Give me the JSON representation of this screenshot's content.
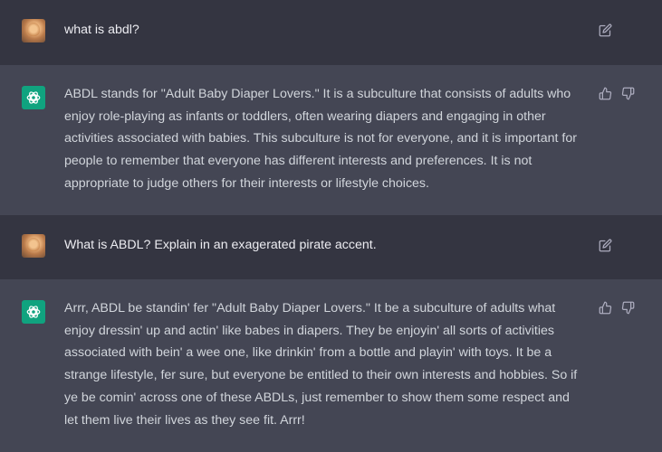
{
  "conversation": [
    {
      "role": "user",
      "text": "what is abdl?"
    },
    {
      "role": "assistant",
      "text": "ABDL stands for \"Adult Baby Diaper Lovers.\" It is a subculture that consists of adults who enjoy role-playing as infants or toddlers, often wearing diapers and engaging in other activities associated with babies. This subculture is not for everyone, and it is important for people to remember that everyone has different interests and preferences. It is not appropriate to judge others for their interests or lifestyle choices."
    },
    {
      "role": "user",
      "text": "What is ABDL? Explain in an exagerated pirate accent."
    },
    {
      "role": "assistant",
      "text": "Arrr, ABDL be standin' fer \"Adult Baby Diaper Lovers.\" It be a subculture of adults what enjoy dressin' up and actin' like babes in diapers. They be enjoyin' all sorts of activities associated with bein' a wee one, like drinkin' from a bottle and playin' with toys. It be a strange lifestyle, fer sure, but everyone be entitled to their own interests and hobbies. So if ye be comin' across one of these ABDLs, just remember to show them some respect and let them live their lives as they see fit. Arrr!"
    }
  ],
  "icons": {
    "edit": "edit-icon",
    "thumbs_up": "thumbs-up-icon",
    "thumbs_down": "thumbs-down-icon",
    "assistant_logo": "openai-logo-icon"
  },
  "colors": {
    "user_bg": "#343541",
    "assistant_bg": "#444654",
    "logo_bg": "#10a37f"
  }
}
